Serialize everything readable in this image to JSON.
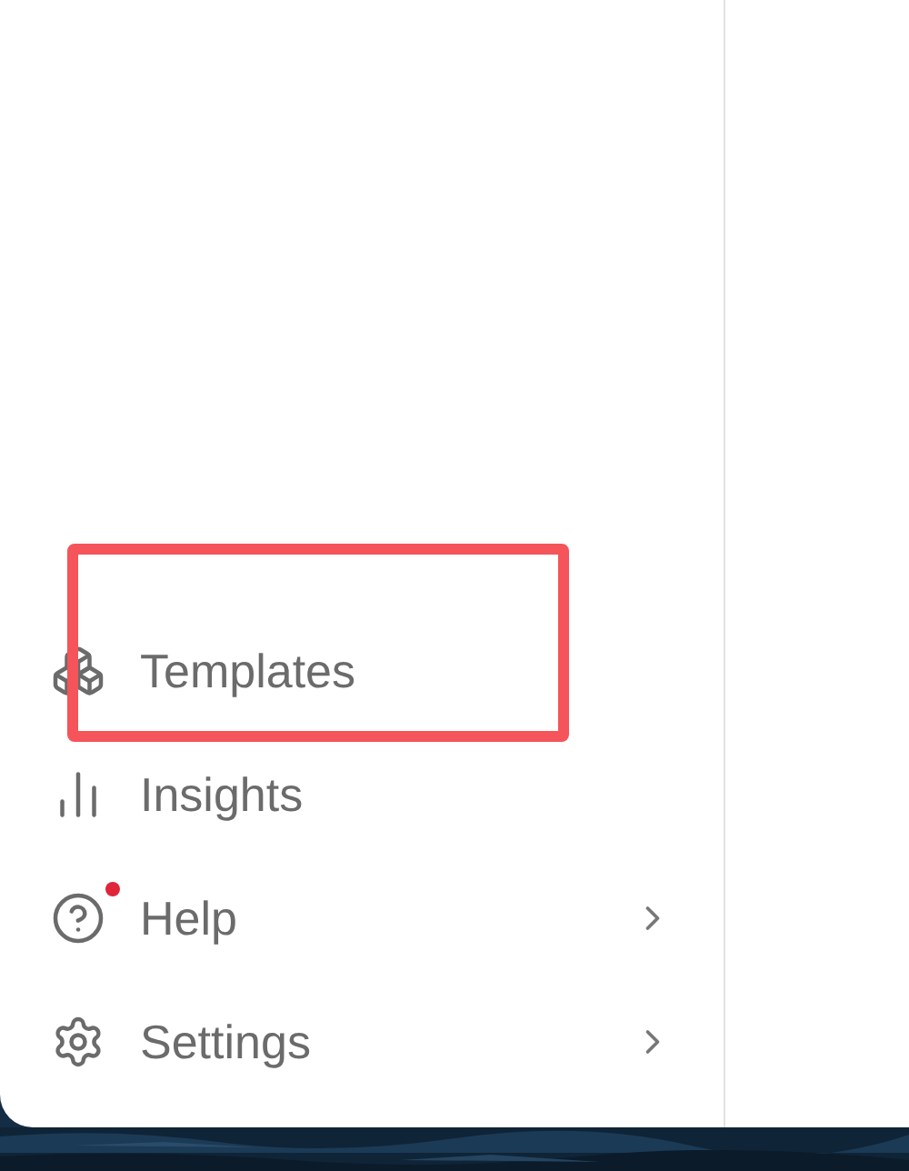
{
  "menu_items": [
    {
      "label": "Templates",
      "kind": "templates",
      "highlighted": true,
      "notification": false,
      "has_submenu": false
    },
    {
      "label": "Insights",
      "kind": "insights",
      "highlighted": false,
      "notification": false,
      "has_submenu": false
    },
    {
      "label": "Help",
      "kind": "help",
      "highlighted": false,
      "notification": true,
      "has_submenu": true
    },
    {
      "label": "Settings",
      "kind": "settings",
      "highlighted": false,
      "notification": false,
      "has_submenu": true
    }
  ]
}
